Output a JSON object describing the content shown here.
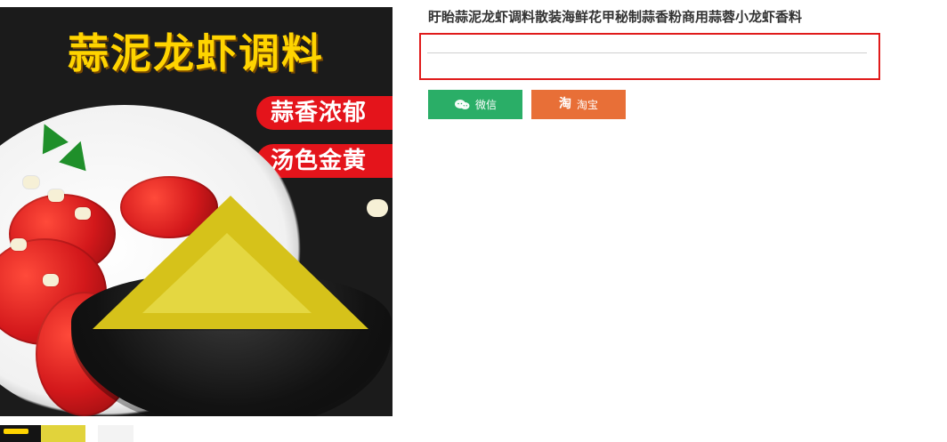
{
  "product": {
    "title": "盱眙蒜泥龙虾调料散装海鲜花甲秘制蒜香粉商用蒜蓉小龙虾香料"
  },
  "main_image": {
    "headline": "蒜泥龙虾调料",
    "tags": [
      "蒜香浓郁",
      "汤色金黄"
    ]
  },
  "share_buttons": [
    {
      "label": "微信",
      "color": "#2aae67",
      "icon": "wechat-icon"
    },
    {
      "label": "淘宝",
      "color": "#e86f37",
      "icon": "taobao-icon",
      "icon_text": "淘"
    }
  ],
  "thumbnails": {
    "count": 3
  },
  "colors": {
    "title_text": "#333333",
    "highlight_border": "#e01b1b",
    "divider": "#cfcfcf"
  }
}
